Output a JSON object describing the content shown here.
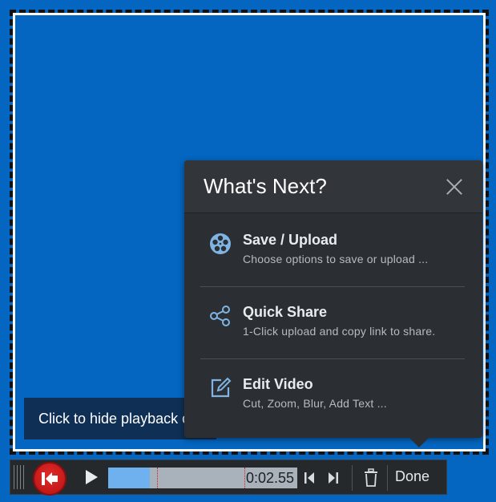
{
  "hint": {
    "text": "Click to hide playback controls"
  },
  "popup": {
    "title": "What's Next?",
    "close_icon": "close-icon",
    "options": [
      {
        "label": "Save / Upload",
        "description": "Choose options to save or upload ...",
        "icon": "film-reel-icon"
      },
      {
        "label": "Quick Share",
        "description": "1-Click upload and copy link to share.",
        "icon": "share-icon"
      },
      {
        "label": "Edit Video",
        "description": "Cut, Zoom, Blur, Add Text ...",
        "icon": "edit-icon"
      }
    ]
  },
  "controls": {
    "time": "0:02.55",
    "progress": 0.22,
    "marker_positions": [
      0.26,
      0.72
    ],
    "done_label": "Done",
    "icons": [
      "drag-grip-icon",
      "record-restart-icon",
      "play-icon",
      "skip-start-icon",
      "skip-end-icon",
      "trash-icon"
    ]
  },
  "colors": {
    "capture_background": "#0466c0",
    "popup_background": "#2b2f33",
    "icon_accent": "#7fb4e4",
    "record_red": "#d21d1d",
    "timeline_fill": "#6fb0ee"
  }
}
